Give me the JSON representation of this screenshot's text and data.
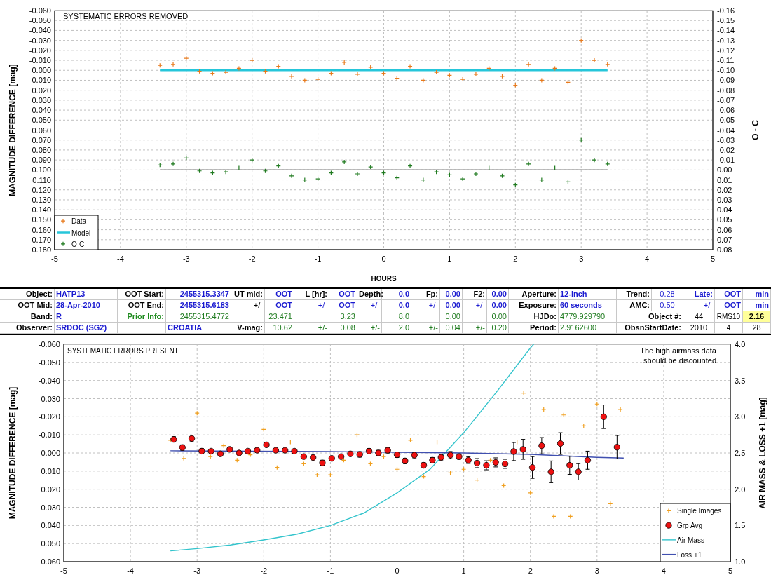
{
  "top_chart": {
    "chart_data": {
      "type": "scatter",
      "title": "SYSTEMATIC ERRORS REMOVED",
      "xlabel": "HOURS",
      "ylabel": "MAGNITUDE DIFFERENCE [mag]",
      "y2label": "O - C",
      "xlim": [
        -5,
        5
      ],
      "ylim": [
        0.18,
        -0.06
      ],
      "y2lim": [
        0.08,
        -0.16
      ],
      "grid": true,
      "legend": true,
      "ref_lines": [
        {
          "axis": "y2",
          "value": 0,
          "color": "#000000"
        }
      ],
      "xticks": [
        -5,
        -4,
        -3,
        -2,
        -1,
        0,
        1,
        2,
        3,
        4,
        5
      ],
      "yticks": [
        {
          "value": -0.06,
          "label": "-0.060"
        },
        {
          "value": -0.05,
          "label": "-0.050"
        },
        {
          "value": -0.04,
          "label": "-0.040"
        },
        {
          "value": -0.03,
          "label": "-0.030"
        },
        {
          "value": -0.02,
          "label": "-0.020"
        },
        {
          "value": -0.01,
          "label": "-0.010"
        },
        {
          "value": 0,
          "label": "0.000"
        },
        {
          "value": 0.01,
          "label": "0.010"
        },
        {
          "value": 0.02,
          "label": "0.020"
        },
        {
          "value": 0.03,
          "label": "0.030"
        },
        {
          "value": 0.04,
          "label": "0.040"
        },
        {
          "value": 0.05,
          "label": "0.050"
        },
        {
          "value": 0.06,
          "label": "0.060"
        },
        {
          "value": 0.07,
          "label": "0.070"
        },
        {
          "value": 0.08,
          "label": "0.080"
        },
        {
          "value": 0.09,
          "label": "0.090"
        },
        {
          "value": 0.1,
          "label": "0.100"
        },
        {
          "value": 0.11,
          "label": "0.110"
        },
        {
          "value": 0.12,
          "label": "0.120"
        },
        {
          "value": 0.13,
          "label": "0.130"
        },
        {
          "value": 0.14,
          "label": "0.140"
        },
        {
          "value": 0.15,
          "label": "0.150"
        },
        {
          "value": 0.16,
          "label": "0.160"
        },
        {
          "value": 0.17,
          "label": "0.170"
        },
        {
          "value": 0.18,
          "label": "0.180"
        }
      ],
      "y2ticks": [
        {
          "value": -0.16,
          "label": "-0.16"
        },
        {
          "value": -0.15,
          "label": "-0.15"
        },
        {
          "value": -0.14,
          "label": "-0.14"
        },
        {
          "value": -0.13,
          "label": "-0.13"
        },
        {
          "value": -0.12,
          "label": "-0.12"
        },
        {
          "value": -0.11,
          "label": "-0.11"
        },
        {
          "value": -0.1,
          "label": "-0.10"
        },
        {
          "value": -0.09,
          "label": "-0.09"
        },
        {
          "value": -0.08,
          "label": "-0.08"
        },
        {
          "value": -0.07,
          "label": "-0.07"
        },
        {
          "value": -0.06,
          "label": "-0.06"
        },
        {
          "value": -0.05,
          "label": "-0.05"
        },
        {
          "value": -0.04,
          "label": "-0.04"
        },
        {
          "value": -0.03,
          "label": "-0.03"
        },
        {
          "value": -0.02,
          "label": "-0.02"
        },
        {
          "value": -0.01,
          "label": "-0.01"
        },
        {
          "value": 0,
          "label": "0.00"
        },
        {
          "value": 0.01,
          "label": "0.01"
        },
        {
          "value": 0.02,
          "label": "0.02"
        },
        {
          "value": 0.03,
          "label": "0.03"
        },
        {
          "value": 0.04,
          "label": "0.04"
        },
        {
          "value": 0.05,
          "label": "0.05"
        },
        {
          "value": 0.06,
          "label": "0.06"
        },
        {
          "value": 0.07,
          "label": "0.07"
        },
        {
          "value": 0.08,
          "label": "0.08"
        }
      ],
      "series": [
        {
          "name": "Data",
          "color": "#e87a1c",
          "type": "scatter",
          "marker": "plus",
          "x": [
            -3.4,
            -3.2,
            -3.0,
            -2.8,
            -2.6,
            -2.4,
            -2.2,
            -2.0,
            -1.8,
            -1.6,
            -1.4,
            -1.2,
            -1.0,
            -0.8,
            -0.6,
            -0.4,
            -0.2,
            0.0,
            0.2,
            0.4,
            0.6,
            0.8,
            1.0,
            1.2,
            1.4,
            1.6,
            1.8,
            2.0,
            2.2,
            2.4,
            2.6,
            2.8,
            3.0,
            3.2,
            3.4
          ],
          "values": [
            -0.005,
            -0.006,
            -0.012,
            0.001,
            0.003,
            0.002,
            -0.002,
            -0.01,
            0.001,
            -0.004,
            0.006,
            0.01,
            0.009,
            0.003,
            -0.008,
            0.004,
            -0.003,
            0.003,
            0.008,
            -0.004,
            0.01,
            0.002,
            0.005,
            0.009,
            0.004,
            -0.002,
            0.006,
            0.015,
            -0.006,
            0.01,
            -0.002,
            0.012,
            -0.03,
            -0.01,
            -0.006
          ]
        },
        {
          "name": "Model",
          "color": "#26c6da",
          "type": "line",
          "x": [
            -3.4,
            3.4
          ],
          "values": [
            0,
            0
          ]
        },
        {
          "name": "O-C",
          "color": "#1f7a1f",
          "type": "scatter",
          "marker": "plus",
          "axis": "y2",
          "x": [
            -3.4,
            -3.2,
            -3.0,
            -2.8,
            -2.6,
            -2.4,
            -2.2,
            -2.0,
            -1.8,
            -1.6,
            -1.4,
            -1.2,
            -1.0,
            -0.8,
            -0.6,
            -0.4,
            -0.2,
            0.0,
            0.2,
            0.4,
            0.6,
            0.8,
            1.0,
            1.2,
            1.4,
            1.6,
            1.8,
            2.0,
            2.2,
            2.4,
            2.6,
            2.8,
            3.0,
            3.2,
            3.4
          ],
          "values": [
            -0.005,
            -0.006,
            -0.012,
            0.001,
            0.003,
            0.002,
            -0.002,
            -0.01,
            0.001,
            -0.004,
            0.006,
            0.01,
            0.009,
            0.003,
            -0.008,
            0.004,
            -0.003,
            0.003,
            0.008,
            -0.004,
            0.01,
            0.002,
            0.005,
            0.009,
            0.004,
            -0.002,
            0.006,
            0.015,
            -0.006,
            0.01,
            -0.002,
            0.012,
            -0.03,
            -0.01,
            -0.006
          ]
        }
      ]
    }
  },
  "info_table": {
    "rows": [
      {
        "cells": [
          {
            "text": "Object:",
            "kind": "label"
          },
          {
            "text": "HATP13",
            "kind": "value_left"
          },
          {
            "text": "OOT Start:",
            "kind": "label"
          },
          {
            "text": "2455315.3347",
            "kind": "value"
          },
          {
            "text": "UT mid:",
            "kind": "label"
          },
          {
            "text": "OOT",
            "kind": "value"
          },
          {
            "text": "L [hr]:",
            "kind": "label"
          },
          {
            "text": "OOT",
            "kind": "value"
          },
          {
            "text": "Depth:",
            "kind": "label"
          },
          {
            "text": "0.0",
            "kind": "value"
          },
          {
            "text": "Fp:",
            "kind": "label"
          },
          {
            "text": "0.00",
            "kind": "value"
          },
          {
            "text": "F2:",
            "kind": "label"
          },
          {
            "text": "0.00",
            "kind": "value"
          },
          {
            "text": "Aperture:",
            "kind": "label"
          },
          {
            "text": "12-inch",
            "kind": "value_left"
          },
          {
            "text": "Trend:",
            "kind": "label"
          },
          {
            "text": "0.28",
            "kind": "value_light"
          },
          {
            "text": "Late:",
            "kind": "value"
          },
          {
            "text": "OOT",
            "kind": "value"
          },
          {
            "text": "min",
            "kind": "value"
          }
        ]
      },
      {
        "cells": [
          {
            "text": "OOT Mid:",
            "kind": "label"
          },
          {
            "text": "28-Apr-2010",
            "kind": "value_left"
          },
          {
            "text": "OOT End:",
            "kind": "label"
          },
          {
            "text": "2455315.6183",
            "kind": "value"
          },
          {
            "text": "+/-",
            "kind": "plain_right"
          },
          {
            "text": "OOT",
            "kind": "value"
          },
          {
            "text": "+/-",
            "kind": "pm"
          },
          {
            "text": "OOT",
            "kind": "value"
          },
          {
            "text": "+/-",
            "kind": "pm"
          },
          {
            "text": "0.0",
            "kind": "value"
          },
          {
            "text": "+/-",
            "kind": "pm"
          },
          {
            "text": "0.00",
            "kind": "value"
          },
          {
            "text": "+/-",
            "kind": "pm"
          },
          {
            "text": "0.00",
            "kind": "value"
          },
          {
            "text": "Exposure:",
            "kind": "label"
          },
          {
            "text": "60 seconds",
            "kind": "value_left"
          },
          {
            "text": "AMC:",
            "kind": "label"
          },
          {
            "text": "0.50",
            "kind": "value_light"
          },
          {
            "text": "+/-",
            "kind": "pm"
          },
          {
            "text": "OOT",
            "kind": "value"
          },
          {
            "text": "min",
            "kind": "value"
          }
        ]
      },
      {
        "cells": [
          {
            "text": "Band:",
            "kind": "label"
          },
          {
            "text": "R",
            "kind": "value_left"
          },
          {
            "text": "Prior Info:",
            "kind": "prior_label"
          },
          {
            "text": "2455315.4772",
            "kind": "prior"
          },
          {
            "kind": "blank"
          },
          {
            "text": "23.471",
            "kind": "prior"
          },
          {
            "kind": "blank"
          },
          {
            "text": "3.23",
            "kind": "prior"
          },
          {
            "kind": "blank"
          },
          {
            "text": "8.0",
            "kind": "prior"
          },
          {
            "kind": "blank"
          },
          {
            "text": "0.00",
            "kind": "prior"
          },
          {
            "kind": "blank"
          },
          {
            "text": "0.00",
            "kind": "prior"
          },
          {
            "text": "HJDo:",
            "kind": "label"
          },
          {
            "text": "4779.929790",
            "kind": "prior_left"
          },
          {
            "text": "Object #:",
            "kind": "label_wide"
          },
          {
            "text": "44",
            "kind": "plain"
          },
          {
            "text": "RMS10",
            "kind": "plain"
          },
          {
            "text": "2.16",
            "kind": "highlight"
          }
        ]
      },
      {
        "cells": [
          {
            "text": "Observer:",
            "kind": "label"
          },
          {
            "text": "SRDOC (SG2)",
            "kind": "value_left"
          },
          {
            "kind": "blank"
          },
          {
            "text": "CROATIA",
            "kind": "value_left"
          },
          {
            "text": "V-mag:",
            "kind": "label"
          },
          {
            "text": "10.62",
            "kind": "prior"
          },
          {
            "text": "+/-",
            "kind": "pm_prior"
          },
          {
            "text": "0.08",
            "kind": "prior"
          },
          {
            "text": "+/-",
            "kind": "pm_prior"
          },
          {
            "text": "2.0",
            "kind": "prior"
          },
          {
            "text": "+/-",
            "kind": "pm_prior"
          },
          {
            "text": "0.04",
            "kind": "prior"
          },
          {
            "text": "+/-",
            "kind": "pm_prior"
          },
          {
            "text": "0.20",
            "kind": "prior"
          },
          {
            "text": "Period:",
            "kind": "label"
          },
          {
            "text": "2.9162600",
            "kind": "prior_left"
          },
          {
            "text": "ObsnStartDate:",
            "kind": "label_wide"
          },
          {
            "text": "2010",
            "kind": "plain"
          },
          {
            "text": "4",
            "kind": "plain"
          },
          {
            "text": "28",
            "kind": "plain"
          }
        ]
      }
    ]
  },
  "bottom_chart": {
    "chart_data": {
      "type": "scatter",
      "title": "SYSTEMATIC ERRORS PRESENT",
      "ylabel": "MAGNITUDE DIFFERENCE [mag]",
      "y2label": "AIR MASS & LOSS +1 [mag]",
      "xlim": [
        -5,
        5
      ],
      "ylim": [
        0.06,
        -0.06
      ],
      "y2lim": [
        1.0,
        4.0
      ],
      "grid": true,
      "legend": true,
      "annotations": [
        {
          "text": "The high airmass data\nshould be discounted"
        }
      ],
      "xticks": [
        -5,
        -4,
        -3,
        -2,
        -1,
        0,
        1,
        2,
        3,
        4,
        5
      ],
      "yticks": [
        {
          "value": -0.06,
          "label": "-0.060"
        },
        {
          "value": -0.05,
          "label": "-0.050"
        },
        {
          "value": -0.04,
          "label": "-0.040"
        },
        {
          "value": -0.03,
          "label": "-0.030"
        },
        {
          "value": -0.02,
          "label": "-0.020"
        },
        {
          "value": -0.01,
          "label": "-0.010"
        },
        {
          "value": 0,
          "label": "0.000"
        },
        {
          "value": 0.01,
          "label": "0.010"
        },
        {
          "value": 0.02,
          "label": "0.020"
        },
        {
          "value": 0.03,
          "label": "0.030"
        },
        {
          "value": 0.04,
          "label": "0.040"
        },
        {
          "value": 0.05,
          "label": "0.050"
        },
        {
          "value": 0.06,
          "label": "0.060"
        }
      ],
      "y2ticks": [
        {
          "value": 1.0,
          "label": "1.0"
        },
        {
          "value": 1.5,
          "label": "1.5"
        },
        {
          "value": 2.0,
          "label": "2.0"
        },
        {
          "value": 2.5,
          "label": "2.5"
        },
        {
          "value": 3.0,
          "label": "3.0"
        },
        {
          "value": 3.5,
          "label": "3.5"
        },
        {
          "value": 4.0,
          "label": "4.0"
        }
      ],
      "series": [
        {
          "name": "Single Images",
          "color": "#f0a020",
          "type": "scatter",
          "marker": "plus",
          "x": [
            -3.4,
            -3.2,
            -3.0,
            -2.8,
            -2.6,
            -2.4,
            -2.2,
            -2.0,
            -1.8,
            -1.6,
            -1.4,
            -1.2,
            -1.0,
            -0.8,
            -0.6,
            -0.4,
            -0.2,
            0.0,
            0.2,
            0.4,
            0.6,
            0.8,
            1.0,
            1.2,
            1.4,
            1.6,
            1.8,
            1.9,
            2.0,
            2.2,
            2.35,
            2.5,
            2.6,
            2.8,
            3.0,
            3.2,
            3.35
          ],
          "values": [
            -0.007,
            0.003,
            -0.022,
            0.002,
            -0.004,
            0.004,
            0.001,
            -0.013,
            0.008,
            -0.006,
            0.006,
            0.012,
            0.012,
            0.004,
            -0.01,
            0.006,
            0.002,
            0.009,
            -0.007,
            0.013,
            -0.006,
            0.011,
            0.009,
            0.015,
            0.004,
            0.018,
            -0.006,
            -0.033,
            0.022,
            -0.024,
            0.035,
            -0.021,
            0.035,
            -0.015,
            -0.027,
            0.028,
            -0.024
          ]
        },
        {
          "name": "Grp Avg",
          "color": "#ee1111",
          "type": "scatter",
          "marker": "circle",
          "x": [
            -3.35,
            -3.22,
            -3.08,
            -2.93,
            -2.79,
            -2.65,
            -2.51,
            -2.37,
            -2.24,
            -2.1,
            -1.96,
            -1.82,
            -1.68,
            -1.54,
            -1.4,
            -1.26,
            -1.12,
            -0.98,
            -0.84,
            -0.7,
            -0.56,
            -0.42,
            -0.28,
            -0.14,
            0.0,
            0.12,
            0.26,
            0.4,
            0.53,
            0.66,
            0.8,
            0.93,
            1.07,
            1.2,
            1.34,
            1.48,
            1.62,
            1.75,
            1.89,
            2.03,
            2.17,
            2.31,
            2.45,
            2.59,
            2.72,
            2.86,
            3.1,
            3.3
          ],
          "values": [
            -0.0075,
            -0.003,
            -0.008,
            -0.001,
            -0.001,
            0.0005,
            -0.002,
            0.0,
            -0.001,
            -0.0015,
            -0.0045,
            -0.0015,
            -0.0015,
            -0.001,
            0.002,
            0.0025,
            0.0055,
            0.003,
            0.002,
            0.0005,
            0.0008,
            -0.001,
            0.0,
            -0.0015,
            0.001,
            0.0044,
            0.0012,
            0.0068,
            0.004,
            0.0024,
            0.0012,
            0.002,
            0.004,
            0.0056,
            0.0068,
            0.0052,
            0.006,
            -0.0008,
            -0.002,
            0.008,
            -0.004,
            0.0104,
            -0.0052,
            0.0068,
            0.0104,
            0.004,
            -0.02,
            -0.0032
          ],
          "errors": [
            0.0015,
            0.0015,
            0.0018,
            0.0015,
            0.001,
            0.001,
            0.001,
            0.001,
            0.001,
            0.0012,
            0.0012,
            0.001,
            0.001,
            0.001,
            0.0012,
            0.0012,
            0.0015,
            0.0012,
            0.0012,
            0.0012,
            0.0015,
            0.0015,
            0.0015,
            0.0015,
            0.0015,
            0.0015,
            0.0015,
            0.0015,
            0.0015,
            0.0015,
            0.002,
            0.0015,
            0.0018,
            0.0025,
            0.0025,
            0.0025,
            0.0025,
            0.005,
            0.0055,
            0.006,
            0.0045,
            0.006,
            0.006,
            0.005,
            0.0045,
            0.005,
            0.0065,
            0.0065
          ]
        },
        {
          "name": "Air Mass",
          "color": "#33c4cc",
          "type": "line",
          "axis": "y2",
          "x": [
            -3.4,
            -3.0,
            -2.5,
            -2.0,
            -1.5,
            -1.0,
            -0.5,
            0.0,
            0.5,
            1.0,
            1.5,
            2.0,
            2.05
          ],
          "values": [
            1.15,
            1.18,
            1.23,
            1.3,
            1.38,
            1.5,
            1.67,
            1.95,
            2.28,
            2.78,
            3.35,
            3.95,
            4.0
          ]
        },
        {
          "name": "Loss +1",
          "color": "#4050b0",
          "type": "line",
          "axis": "y2",
          "x": [
            -3.4,
            -1.0,
            0.0,
            1.0,
            2.0,
            3.0,
            3.4
          ],
          "values": [
            2.53,
            2.52,
            2.51,
            2.5,
            2.48,
            2.44,
            2.43
          ]
        }
      ]
    }
  }
}
